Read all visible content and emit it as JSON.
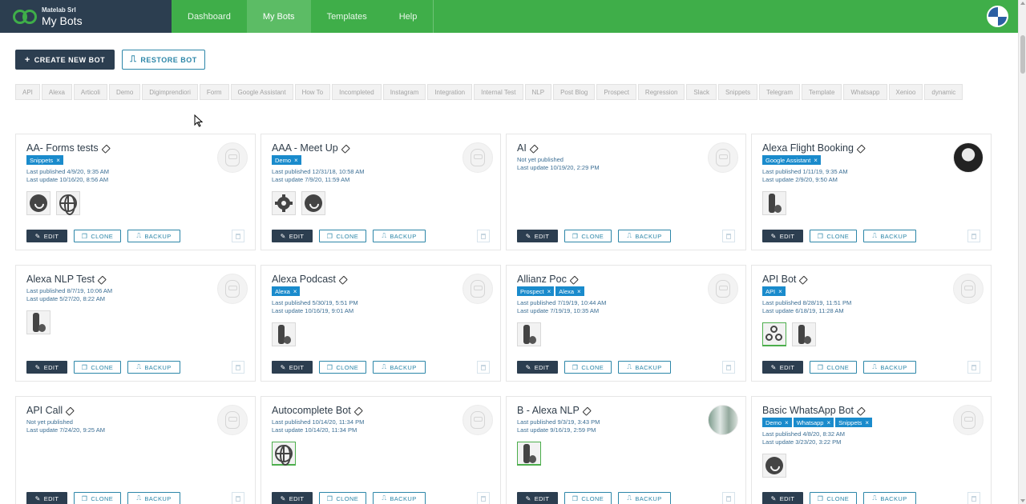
{
  "header": {
    "company": "Matelab Srl",
    "app_name": "My Bots",
    "nav": [
      {
        "label": "Dashboard",
        "active": false
      },
      {
        "label": "My Bots",
        "active": true
      },
      {
        "label": "Templates",
        "active": false
      },
      {
        "label": "Help",
        "active": false
      }
    ],
    "brand_color": "#3fae49",
    "dark_color": "#2c3e50"
  },
  "actions": {
    "create_label": "CREATE NEW BOT",
    "restore_label": "RESTORE BOT"
  },
  "tags": [
    "API",
    "Alexa",
    "Articoli",
    "Demo",
    "Digimprendiori",
    "Form",
    "Google Assistant",
    "How To",
    "Incompleted",
    "Instagram",
    "Integration",
    "Internal Test",
    "NLP",
    "Post Blog",
    "Prospect",
    "Regression",
    "Slack",
    "Snippets",
    "Telegram",
    "Template",
    "Whatsapp",
    "Xenioo",
    "dynamic"
  ],
  "card_actions": {
    "edit": "EDIT",
    "clone": "CLONE",
    "backup": "BACKUP"
  },
  "bots": [
    {
      "name": "AA- Forms tests",
      "tags": [
        "Snippets"
      ],
      "published": "Last published 4/9/20, 9:35 AM",
      "updated": "Last update 10/16/20, 8:56 AM",
      "avatar": "robot",
      "channels": [
        {
          "icon": "whatsapp-icon",
          "active": false
        },
        {
          "icon": "web-icon",
          "active": false
        }
      ]
    },
    {
      "name": "AAA - Meet Up",
      "tags": [
        "Demo"
      ],
      "published": "Last published 12/31/18, 10:58 AM",
      "updated": "Last update 7/9/20, 11:59 AM",
      "avatar": "robot",
      "channels": [
        {
          "icon": "gear-icon",
          "active": false
        },
        {
          "icon": "whatsapp-icon",
          "active": false
        }
      ]
    },
    {
      "name": "AI",
      "tags": [],
      "published": "Not yet published",
      "updated": "Last update 10/19/20, 2:29 PM",
      "avatar": "robot",
      "channels": []
    },
    {
      "name": "Alexa Flight Booking",
      "tags": [
        "Google Assistant"
      ],
      "published": "Last published 1/11/19, 9:35 AM",
      "updated": "Last update 2/9/20, 9:50 AM",
      "avatar": "photo-dark",
      "channels": [
        {
          "icon": "alexa-icon",
          "active": false
        }
      ]
    },
    {
      "name": "Alexa NLP Test",
      "tags": [],
      "published": "Last published 8/7/19, 10:06 AM",
      "updated": "Last update 5/27/20, 8:22 AM",
      "avatar": "robot",
      "channels": [
        {
          "icon": "alexa-icon",
          "active": false
        }
      ]
    },
    {
      "name": "Alexa Podcast",
      "tags": [
        "Alexa"
      ],
      "published": "Last published 5/30/19, 5:51 PM",
      "updated": "Last update 10/16/19, 9:01 AM",
      "avatar": "robot",
      "channels": [
        {
          "icon": "alexa-icon",
          "active": false
        }
      ]
    },
    {
      "name": "Allianz Poc",
      "tags": [
        "Prospect",
        "Alexa"
      ],
      "published": "Last published 7/19/19, 10:44 AM",
      "updated": "Last update 7/19/19, 10:35 AM",
      "avatar": "robot",
      "channels": [
        {
          "icon": "alexa-icon",
          "active": false
        }
      ]
    },
    {
      "name": "API Bot",
      "tags": [
        "API"
      ],
      "published": "Last published 8/28/19, 11:51 PM",
      "updated": "Last update 6/18/19, 11:28 AM",
      "avatar": "robot",
      "channels": [
        {
          "icon": "webhook-icon",
          "active": true
        },
        {
          "icon": "alexa-icon",
          "active": false
        }
      ]
    },
    {
      "name": "API Call",
      "tags": [],
      "published": "Not yet published",
      "updated": "Last update 7/24/20, 9:25 AM",
      "avatar": "robot",
      "channels": []
    },
    {
      "name": "Autocomplete Bot",
      "tags": [],
      "published": "Last published 10/14/20, 11:34 PM",
      "updated": "Last update 10/14/20, 11:34 PM",
      "avatar": "robot",
      "channels": [
        {
          "icon": "web-icon",
          "active": true
        }
      ]
    },
    {
      "name": "B - Alexa NLP",
      "tags": [],
      "published": "Last published 9/3/19, 3:43 PM",
      "updated": "Last update 9/16/19, 2:59 PM",
      "avatar": "photo-light",
      "channels": [
        {
          "icon": "alexa-icon",
          "active": true
        }
      ]
    },
    {
      "name": "Basic WhatsApp Bot",
      "tags": [
        "Demo",
        "Whatsapp",
        "Snippets"
      ],
      "published": "Last published 4/8/20, 8:32 AM",
      "updated": "Last update 3/23/20, 3:22 PM",
      "avatar": "robot",
      "channels": [
        {
          "icon": "whatsapp-icon",
          "active": false
        }
      ]
    }
  ]
}
